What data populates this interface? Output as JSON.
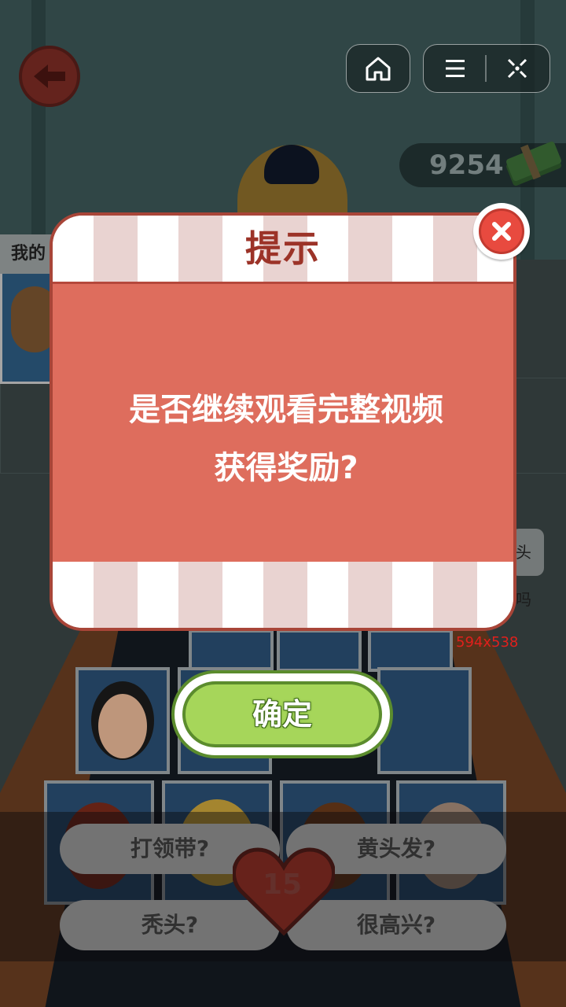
{
  "top_bar": {
    "back_icon": "arrow-left-icon",
    "home_icon": "home-icon",
    "menu_icon": "menu-icon",
    "close_mini_icon": "close-icon"
  },
  "currency": {
    "amount": "9254",
    "icon": "cash-stack-icon"
  },
  "player_card": {
    "label": "我的"
  },
  "side_bubble": {
    "text": "头吗"
  },
  "debug_label": "594x538",
  "dialog": {
    "title": "提示",
    "message_line1": "是否继续观看完整视频",
    "message_line2": "获得奖励?",
    "close_icon": "close-icon",
    "confirm_label": "确定"
  },
  "questions": [
    {
      "label": "打领带?"
    },
    {
      "label": "黄头发?"
    },
    {
      "label": "秃头?"
    },
    {
      "label": "很高兴?"
    }
  ],
  "lives": {
    "icon": "heart-icon",
    "count": "15"
  },
  "colors": {
    "popup_body": "#de6d5d",
    "popup_title": "#9c3328",
    "confirm_green": "#a6d65a",
    "close_red": "#e84a3f"
  }
}
